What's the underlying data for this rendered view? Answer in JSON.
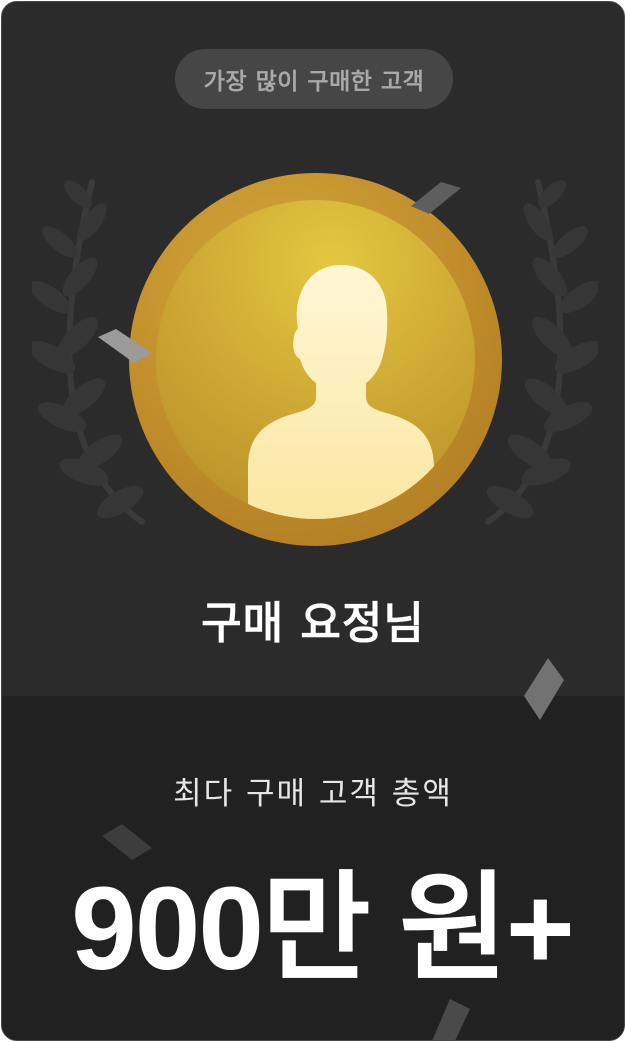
{
  "badge": {
    "label": "가장 많이 구매한 고객"
  },
  "profile": {
    "name": "구매 요정님",
    "avatar_icon": "person-silhouette-icon",
    "medal_color": "#c9992e"
  },
  "summary": {
    "label": "최다 구매 고객 총액",
    "value": "900만 원+"
  },
  "decorations": {
    "laurel_icon": "laurel-wreath-icon",
    "confetti_icon": "confetti-icon"
  }
}
